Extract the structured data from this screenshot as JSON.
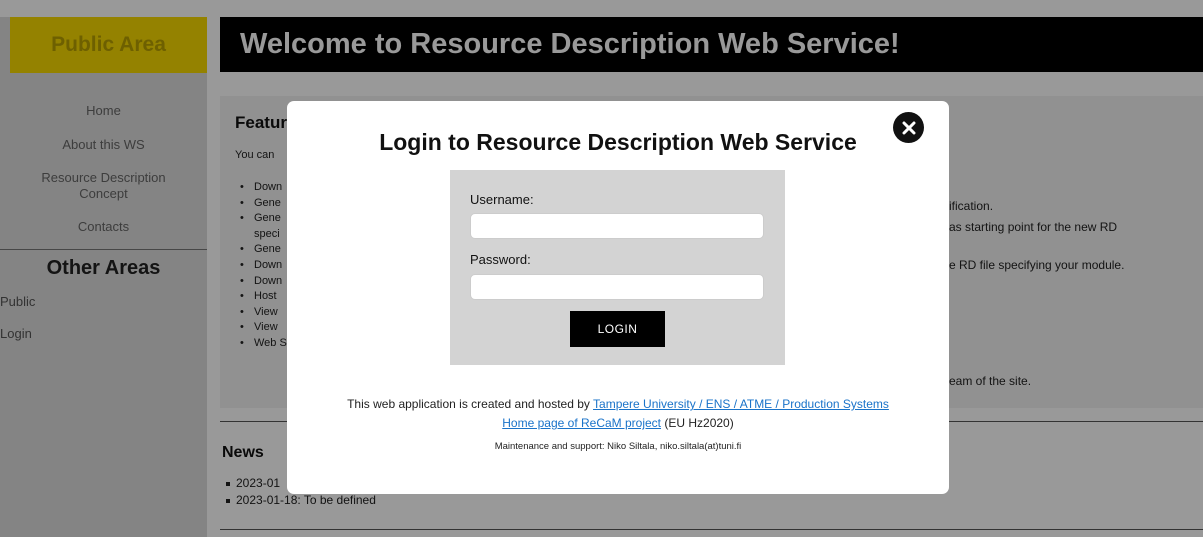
{
  "sidebar": {
    "header": "Public Area",
    "nav": [
      {
        "label": "Home"
      },
      {
        "label": "About this WS"
      },
      {
        "label": "Resource Description"
      },
      {
        "label": "Concept"
      },
      {
        "label": "Contacts"
      }
    ],
    "other_areas_title": "Other Areas",
    "other_links": [
      {
        "label": "Public"
      },
      {
        "label": "Login"
      }
    ]
  },
  "main": {
    "header_title": "Welcome to Resource Description Web Service!",
    "features": {
      "title": "Featur",
      "intro": "You can",
      "items": [
        "Down",
        "Gene",
        "Gene",
        "speci",
        "Gene",
        "Down",
        "Down",
        "Host",
        "View",
        "View",
        "Web S"
      ],
      "right_fragments": [
        "ification.",
        "as starting point for the new RD",
        "e RD file specifying your module.",
        "eam of the site."
      ]
    },
    "news": {
      "title": "News",
      "items": [
        "2023-01",
        "2023-01-18: To be defined"
      ]
    }
  },
  "modal": {
    "title": "Login to Resource Description Web Service",
    "close_icon": "close-icon",
    "username_label": "Username:",
    "username_value": "",
    "password_label": "Password:",
    "password_value": "",
    "login_button": "LOGIN",
    "credit_prefix": "This web application is created and hosted by ",
    "credit_link": "Tampere University / ENS / ATME / Production Systems",
    "homepage_link": "Home page of ReCaM project",
    "homepage_suffix": " (EU Hz2020)",
    "maintenance": "Maintenance and support: Niko Siltala, niko.siltala(at)tuni.fi"
  },
  "colors": {
    "sidebar_header": "#f7d900",
    "header_bg": "#000000",
    "link": "#1a73c9"
  }
}
